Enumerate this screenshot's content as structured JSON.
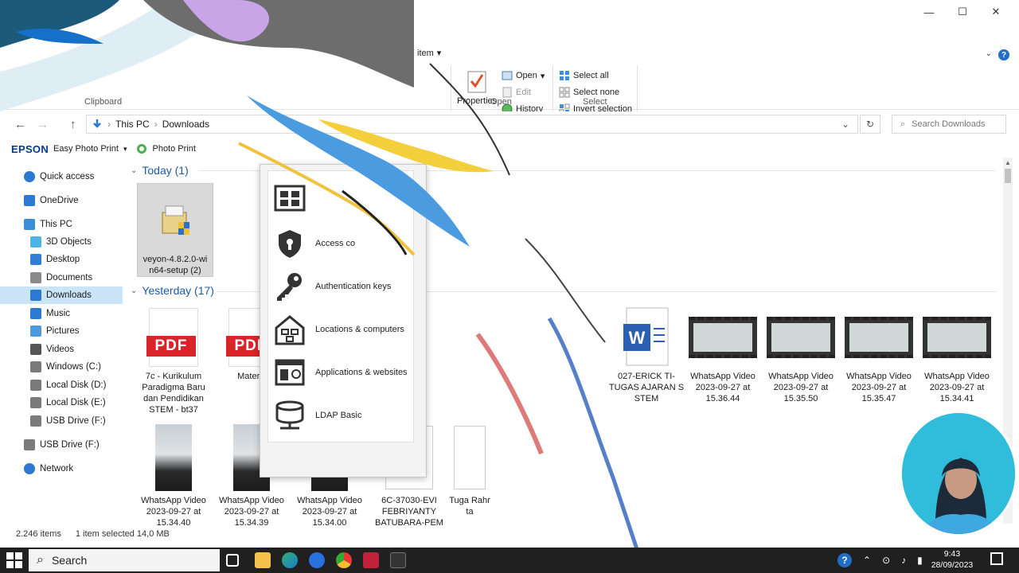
{
  "window": {
    "controls": {
      "minimize": "—",
      "maximize": "☐",
      "close": "✕"
    },
    "help": "?"
  },
  "ribbon": {
    "clipboard_label": "Clipboard",
    "new_item_fragment": "item",
    "open_group": {
      "label": "Open",
      "properties": "Properties",
      "open": "Open",
      "edit": "Edit",
      "history": "History"
    },
    "select_group": {
      "label": "Select",
      "select_all": "Select all",
      "select_none": "Select none",
      "invert_selection": "Invert selection"
    }
  },
  "address": {
    "crumb_1": "This PC",
    "crumb_2": "Downloads",
    "search_placeholder": "Search Downloads"
  },
  "epson": {
    "brand": "EPSON",
    "easy_photo_print": "Easy Photo Print",
    "photo_print": "Photo Print"
  },
  "sidebar": {
    "items": [
      {
        "label": "Quick access",
        "icon": "star-icon"
      },
      {
        "label": "OneDrive",
        "icon": "cloud-icon"
      },
      {
        "label": "This PC",
        "icon": "computer-icon"
      },
      {
        "label": "3D Objects",
        "icon": "cube-icon"
      },
      {
        "label": "Desktop",
        "icon": "desktop-icon"
      },
      {
        "label": "Documents",
        "icon": "document-icon"
      },
      {
        "label": "Downloads",
        "icon": "download-icon"
      },
      {
        "label": "Music",
        "icon": "music-icon"
      },
      {
        "label": "Pictures",
        "icon": "picture-icon"
      },
      {
        "label": "Videos",
        "icon": "video-icon"
      },
      {
        "label": "Windows (C:)",
        "icon": "drive-icon"
      },
      {
        "label": "Local Disk (D:)",
        "icon": "drive-icon"
      },
      {
        "label": "Local Disk (E:)",
        "icon": "drive-icon"
      },
      {
        "label": "USB Drive (F:)",
        "icon": "usb-icon"
      },
      {
        "label": "USB Drive (F:)",
        "icon": "usb-icon"
      },
      {
        "label": "Network",
        "icon": "network-icon"
      }
    ]
  },
  "groups": {
    "today": "Today (1)",
    "yesterday": "Yesterday (17)"
  },
  "files": {
    "today": [
      {
        "name": "veyon-4.8.2.0-win64-setup (2)"
      }
    ],
    "row1": [
      {
        "name": "7c - Kurikulum Paradigma Baru dan Pendidikan STEM - bt37",
        "type": "pdf",
        "badge": "PDF"
      },
      {
        "name": "Materi 6",
        "type": "pdf",
        "badge": "PDF"
      },
      {
        "name": "027-ERICK TI-TUGAS AJARAN S STEM",
        "type": "word"
      },
      {
        "name": "WhatsApp Video 2023-09-27 at 15.36.44",
        "type": "video"
      },
      {
        "name": "WhatsApp Video 2023-09-27 at 15.35.50",
        "type": "video"
      },
      {
        "name": "WhatsApp Video 2023-09-27 at 15.35.47",
        "type": "video"
      },
      {
        "name": "WhatsApp Video 2023-09-27 at 15.34.41",
        "type": "video"
      }
    ],
    "row2": [
      {
        "name": "WhatsApp Video 2023-09-27 at 15.34.40",
        "type": "phone"
      },
      {
        "name": "WhatsApp Video 2023-09-27 at 15.34.39",
        "type": "phone"
      },
      {
        "name": "WhatsApp Video 2023-09-27 at 15.34.00",
        "type": "phone"
      },
      {
        "name": "6C-37030-EVI FEBRIYANTY BATUBARA-PEM",
        "type": "doc"
      },
      {
        "name": "Tuga Rahr ta",
        "type": "doc"
      }
    ]
  },
  "veyon_menu": {
    "items": [
      {
        "label": "",
        "icon": "grid-icon"
      },
      {
        "label": "Access co",
        "icon": "shield-lock-icon"
      },
      {
        "label": "Authentication keys",
        "icon": "key-icon"
      },
      {
        "label": "Locations & computers",
        "icon": "house-network-icon"
      },
      {
        "label": "Applications & websites",
        "icon": "app-window-icon"
      },
      {
        "label": "LDAP Basic",
        "icon": "database-icon"
      }
    ]
  },
  "status": {
    "items_count": "2.246 items",
    "selected": "1 item selected  14,0 MB"
  },
  "taskbar": {
    "search": "Search",
    "time": "9:43",
    "date": "28/09/2023"
  }
}
